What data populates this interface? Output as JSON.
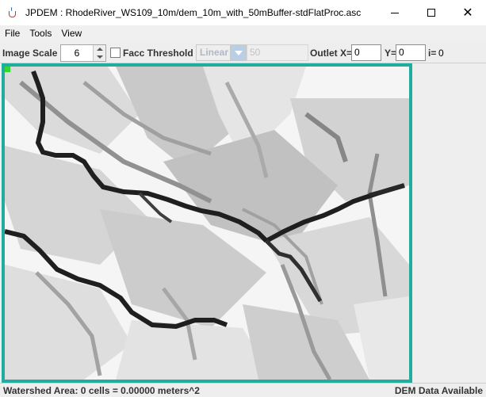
{
  "window": {
    "title": "JPDEM : RhodeRiver_WS109_10m/dem_10m_with_50mBuffer-stdFlatProc.asc",
    "minimize_icon": "minimize-icon",
    "maximize_icon": "maximize-icon",
    "close_icon": "close-icon",
    "close_glyph": "✕"
  },
  "menu": {
    "items": [
      "File",
      "Tools",
      "View"
    ]
  },
  "toolbar": {
    "image_scale_label": "Image Scale",
    "image_scale_value": "6",
    "facc_threshold_label": "Facc Threshold",
    "facc_threshold_checked": false,
    "scale_mode": "Linear",
    "threshold_value": "50",
    "outlet_x_label": "Outlet X=",
    "outlet_x_value": "0",
    "y_label": "Y=",
    "y_value": "0",
    "i_label": "i=",
    "i_value": "0"
  },
  "canvas": {
    "description_icon": "dem-flow-accumulation-map",
    "frame_color": "#20ada0",
    "outlet_marker_color": "#33d633"
  },
  "status": {
    "watershed_area": "Watershed Area: 0 cells = 0.00000 meters^2",
    "dem_status": "DEM Data Available"
  }
}
